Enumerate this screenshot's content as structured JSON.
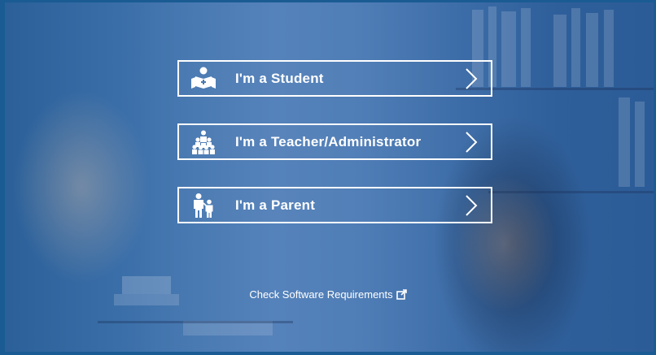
{
  "roles": [
    {
      "label": "I'm a Student",
      "icon": "student-reading-icon"
    },
    {
      "label": "I'm a Teacher/Administrator",
      "icon": "teacher-group-icon"
    },
    {
      "label": "I'm a Parent",
      "icon": "parent-child-icon"
    }
  ],
  "footer": {
    "link_label": "Check Software Requirements",
    "link_icon": "external-link-icon"
  },
  "colors": {
    "overlay": "#3f70ac",
    "frame": "#1a5b93",
    "text": "#ffffff"
  }
}
